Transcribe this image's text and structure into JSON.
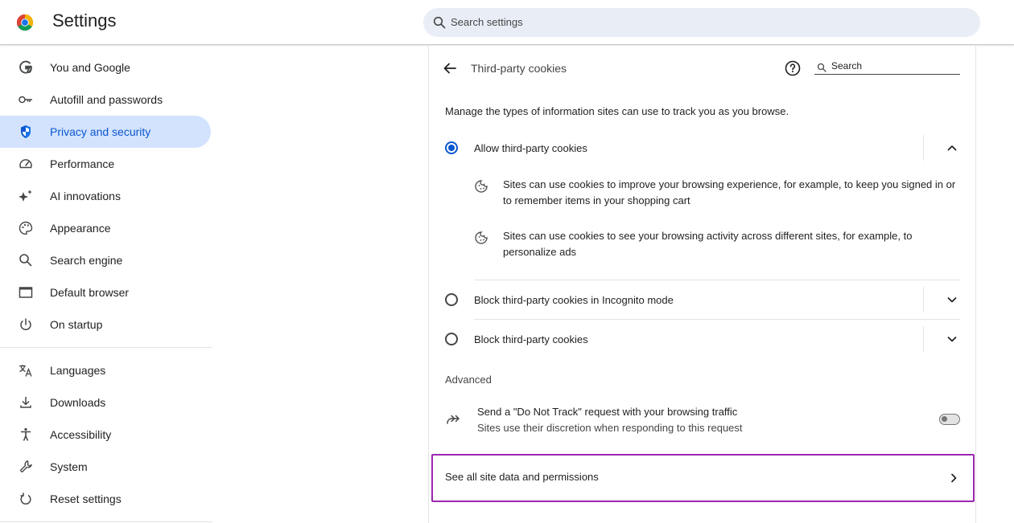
{
  "header": {
    "app_title": "Settings",
    "search_placeholder": "Search settings"
  },
  "sidebar": {
    "items": [
      {
        "label": "You and Google",
        "icon": "google-g-icon"
      },
      {
        "label": "Autofill and passwords",
        "icon": "key-icon"
      },
      {
        "label": "Privacy and security",
        "icon": "shield-icon",
        "active": true
      },
      {
        "label": "Performance",
        "icon": "speedometer-icon"
      },
      {
        "label": "AI innovations",
        "icon": "sparkle-icon"
      },
      {
        "label": "Appearance",
        "icon": "palette-icon"
      },
      {
        "label": "Search engine",
        "icon": "search-icon"
      },
      {
        "label": "Default browser",
        "icon": "browser-window-icon"
      },
      {
        "label": "On startup",
        "icon": "power-icon"
      },
      {
        "label": "Languages",
        "icon": "translate-icon"
      },
      {
        "label": "Downloads",
        "icon": "download-icon"
      },
      {
        "label": "Accessibility",
        "icon": "accessibility-icon"
      },
      {
        "label": "System",
        "icon": "wrench-icon"
      },
      {
        "label": "Reset settings",
        "icon": "reset-icon"
      }
    ]
  },
  "page": {
    "title": "Third-party cookies",
    "search_label": "Search",
    "description": "Manage the types of information sites can use to track you as you browse.",
    "options": [
      {
        "label": "Allow third-party cookies",
        "selected": true,
        "expanded": true,
        "bullets": [
          "Sites can use cookies to improve your browsing experience, for example, to keep you signed in or to remember items in your shopping cart",
          "Sites can use cookies to see your browsing activity across different sites, for example, to personalize ads"
        ]
      },
      {
        "label": "Block third-party cookies in Incognito mode",
        "selected": false,
        "expanded": false
      },
      {
        "label": "Block third-party cookies",
        "selected": false,
        "expanded": false
      }
    ],
    "advanced": {
      "heading": "Advanced",
      "dnt_title": "Send a \"Do Not Track\" request with your browsing traffic",
      "dnt_subtitle": "Sites use their discretion when responding to this request",
      "dnt_enabled": false
    },
    "all_site_data_label": "See all site data and permissions"
  },
  "colors": {
    "accent": "#0b57d0",
    "active_bg": "#d3e3fd",
    "search_bg": "#e9eef6",
    "highlight_border": "#9c27b0"
  }
}
